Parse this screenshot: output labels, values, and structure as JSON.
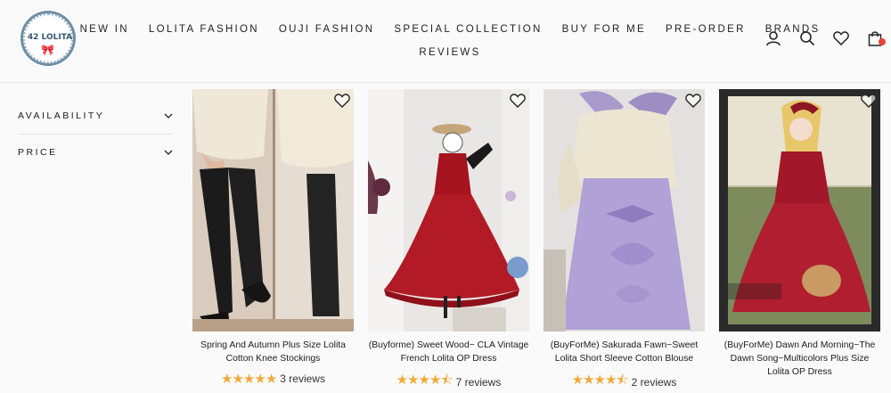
{
  "logo": {
    "text": "42 LOLITA"
  },
  "nav": {
    "row1": [
      "NEW IN",
      "LOLITA FASHION",
      "OUJI FASHION",
      "SPECIAL COLLECTION",
      "BUY FOR ME",
      "PRE-ORDER",
      "BRANDS"
    ],
    "row2": [
      "REVIEWS"
    ]
  },
  "header_icons": [
    "account-icon",
    "search-icon",
    "wishlist-heart-icon",
    "cart-bag-icon"
  ],
  "filters": [
    {
      "label": "AVAILABILITY"
    },
    {
      "label": "PRICE"
    }
  ],
  "products": [
    {
      "title": "Spring And Autumn Plus Size Lolita Cotton Knee Stockings",
      "stars": "★★★★★",
      "rating": 5,
      "reviews": "3 reviews"
    },
    {
      "title": "(Buyforme) Sweet Wood~ CLA Vintage French Lolita OP Dress",
      "stars": "★★★★⯪",
      "rating": 4.5,
      "reviews": "7 reviews"
    },
    {
      "title": "(BuyForMe) Sakurada Fawn~Sweet Lolita Short Sleeve Cotton Blouse",
      "stars": "★★★★⯪",
      "rating": 4.5,
      "reviews": "2 reviews"
    },
    {
      "title": "(BuyForMe) Dawn And Morning~The Dawn Song~Multicolors Plus Size Lolita OP Dress",
      "stars": "",
      "rating": null,
      "reviews": ""
    }
  ],
  "colors": {
    "accent_star": "#f2a93b",
    "cart_badge": "#e8443a",
    "logo_blue": "#6f8fa3"
  }
}
